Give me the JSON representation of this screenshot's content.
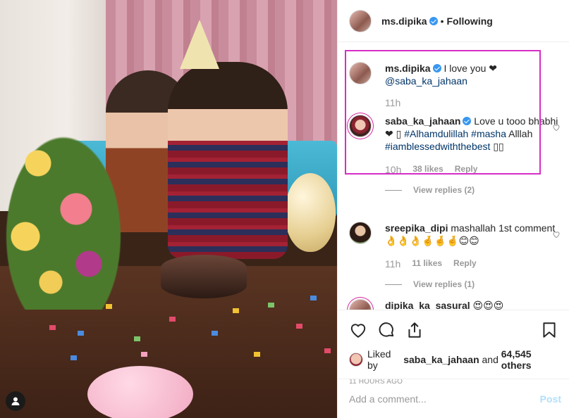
{
  "post": {
    "author": "ms.dipika",
    "separator": "•",
    "follow_status": "Following"
  },
  "comments": [
    {
      "username": "ms.dipika",
      "text": "I love you ❤",
      "mention": "@saba_ka_jahaan",
      "time": "11h"
    },
    {
      "username": "saba_ka_jahaan",
      "text_pre": "Love u tooo bhabhi ❤ ▯",
      "hashtag1": "#Alhamdulillah",
      "hashtag2": "#masha",
      "text_mid": "Alllah",
      "hashtag3": "#iamblessedwiththebest",
      "text_post": "▯▯",
      "time": "10h",
      "likes": "38 likes",
      "reply_label": "Reply",
      "view_replies": "View replies (2)"
    },
    {
      "username": "sreepika_dipi",
      "text": "mashallah 1st comment👌👌👌🤞🤞🤞😊😊",
      "time": "11h",
      "likes": "11 likes",
      "reply_label": "Reply",
      "view_replies": "View replies (1)"
    },
    {
      "username": "dipika_ka_sasural",
      "text": "😍😍😍"
    }
  ],
  "likes": {
    "prefix": "Liked by",
    "user": "saba_ka_jahaan",
    "connector": "and",
    "others": "64,545 others"
  },
  "timestamp": "11 HOURS AGO",
  "add_comment": {
    "placeholder": "Add a comment...",
    "post_label": "Post"
  },
  "colors": {
    "verified": "#3897f0",
    "link": "#003569",
    "highlight": "#d62ec7",
    "post_disabled": "#b2dffc"
  },
  "icons": [
    "heart-icon",
    "comment-icon",
    "share-icon",
    "bookmark-icon",
    "user-tag-icon",
    "verified-icon"
  ]
}
